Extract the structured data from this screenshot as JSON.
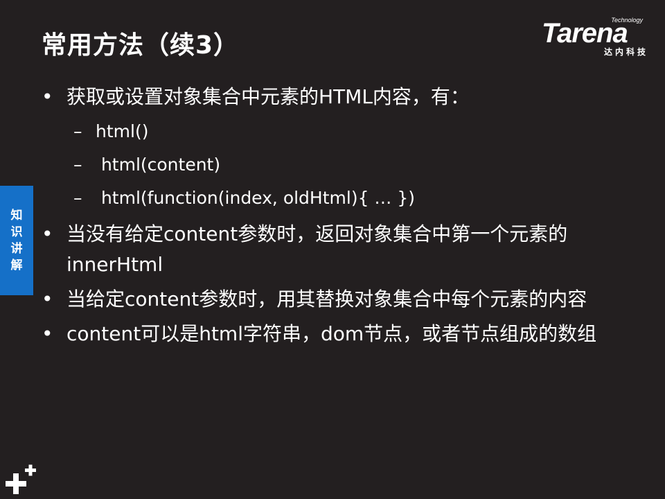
{
  "slide": {
    "title": "常用方法（续3）",
    "logo": {
      "small": "Technology",
      "main": "Tarena",
      "sub": "达内科技"
    },
    "side_tab": [
      "知",
      "识",
      "讲",
      "解"
    ],
    "bullet_char": "•",
    "dash_char": "–",
    "bullets": [
      {
        "text": "获取或设置对象集合中元素的HTML内容，有：",
        "subs": [
          "html()",
          " html(content)",
          " html(function(index, oldHtml){ … })"
        ]
      },
      {
        "text": "当没有给定content参数时，返回对象集合中第一个元素的innerHtml"
      },
      {
        "text": "当给定content参数时，用其替换对象集合中每个元素的内容"
      },
      {
        "text": "content可以是html字符串，dom节点，或者节点组成的数组"
      }
    ]
  }
}
